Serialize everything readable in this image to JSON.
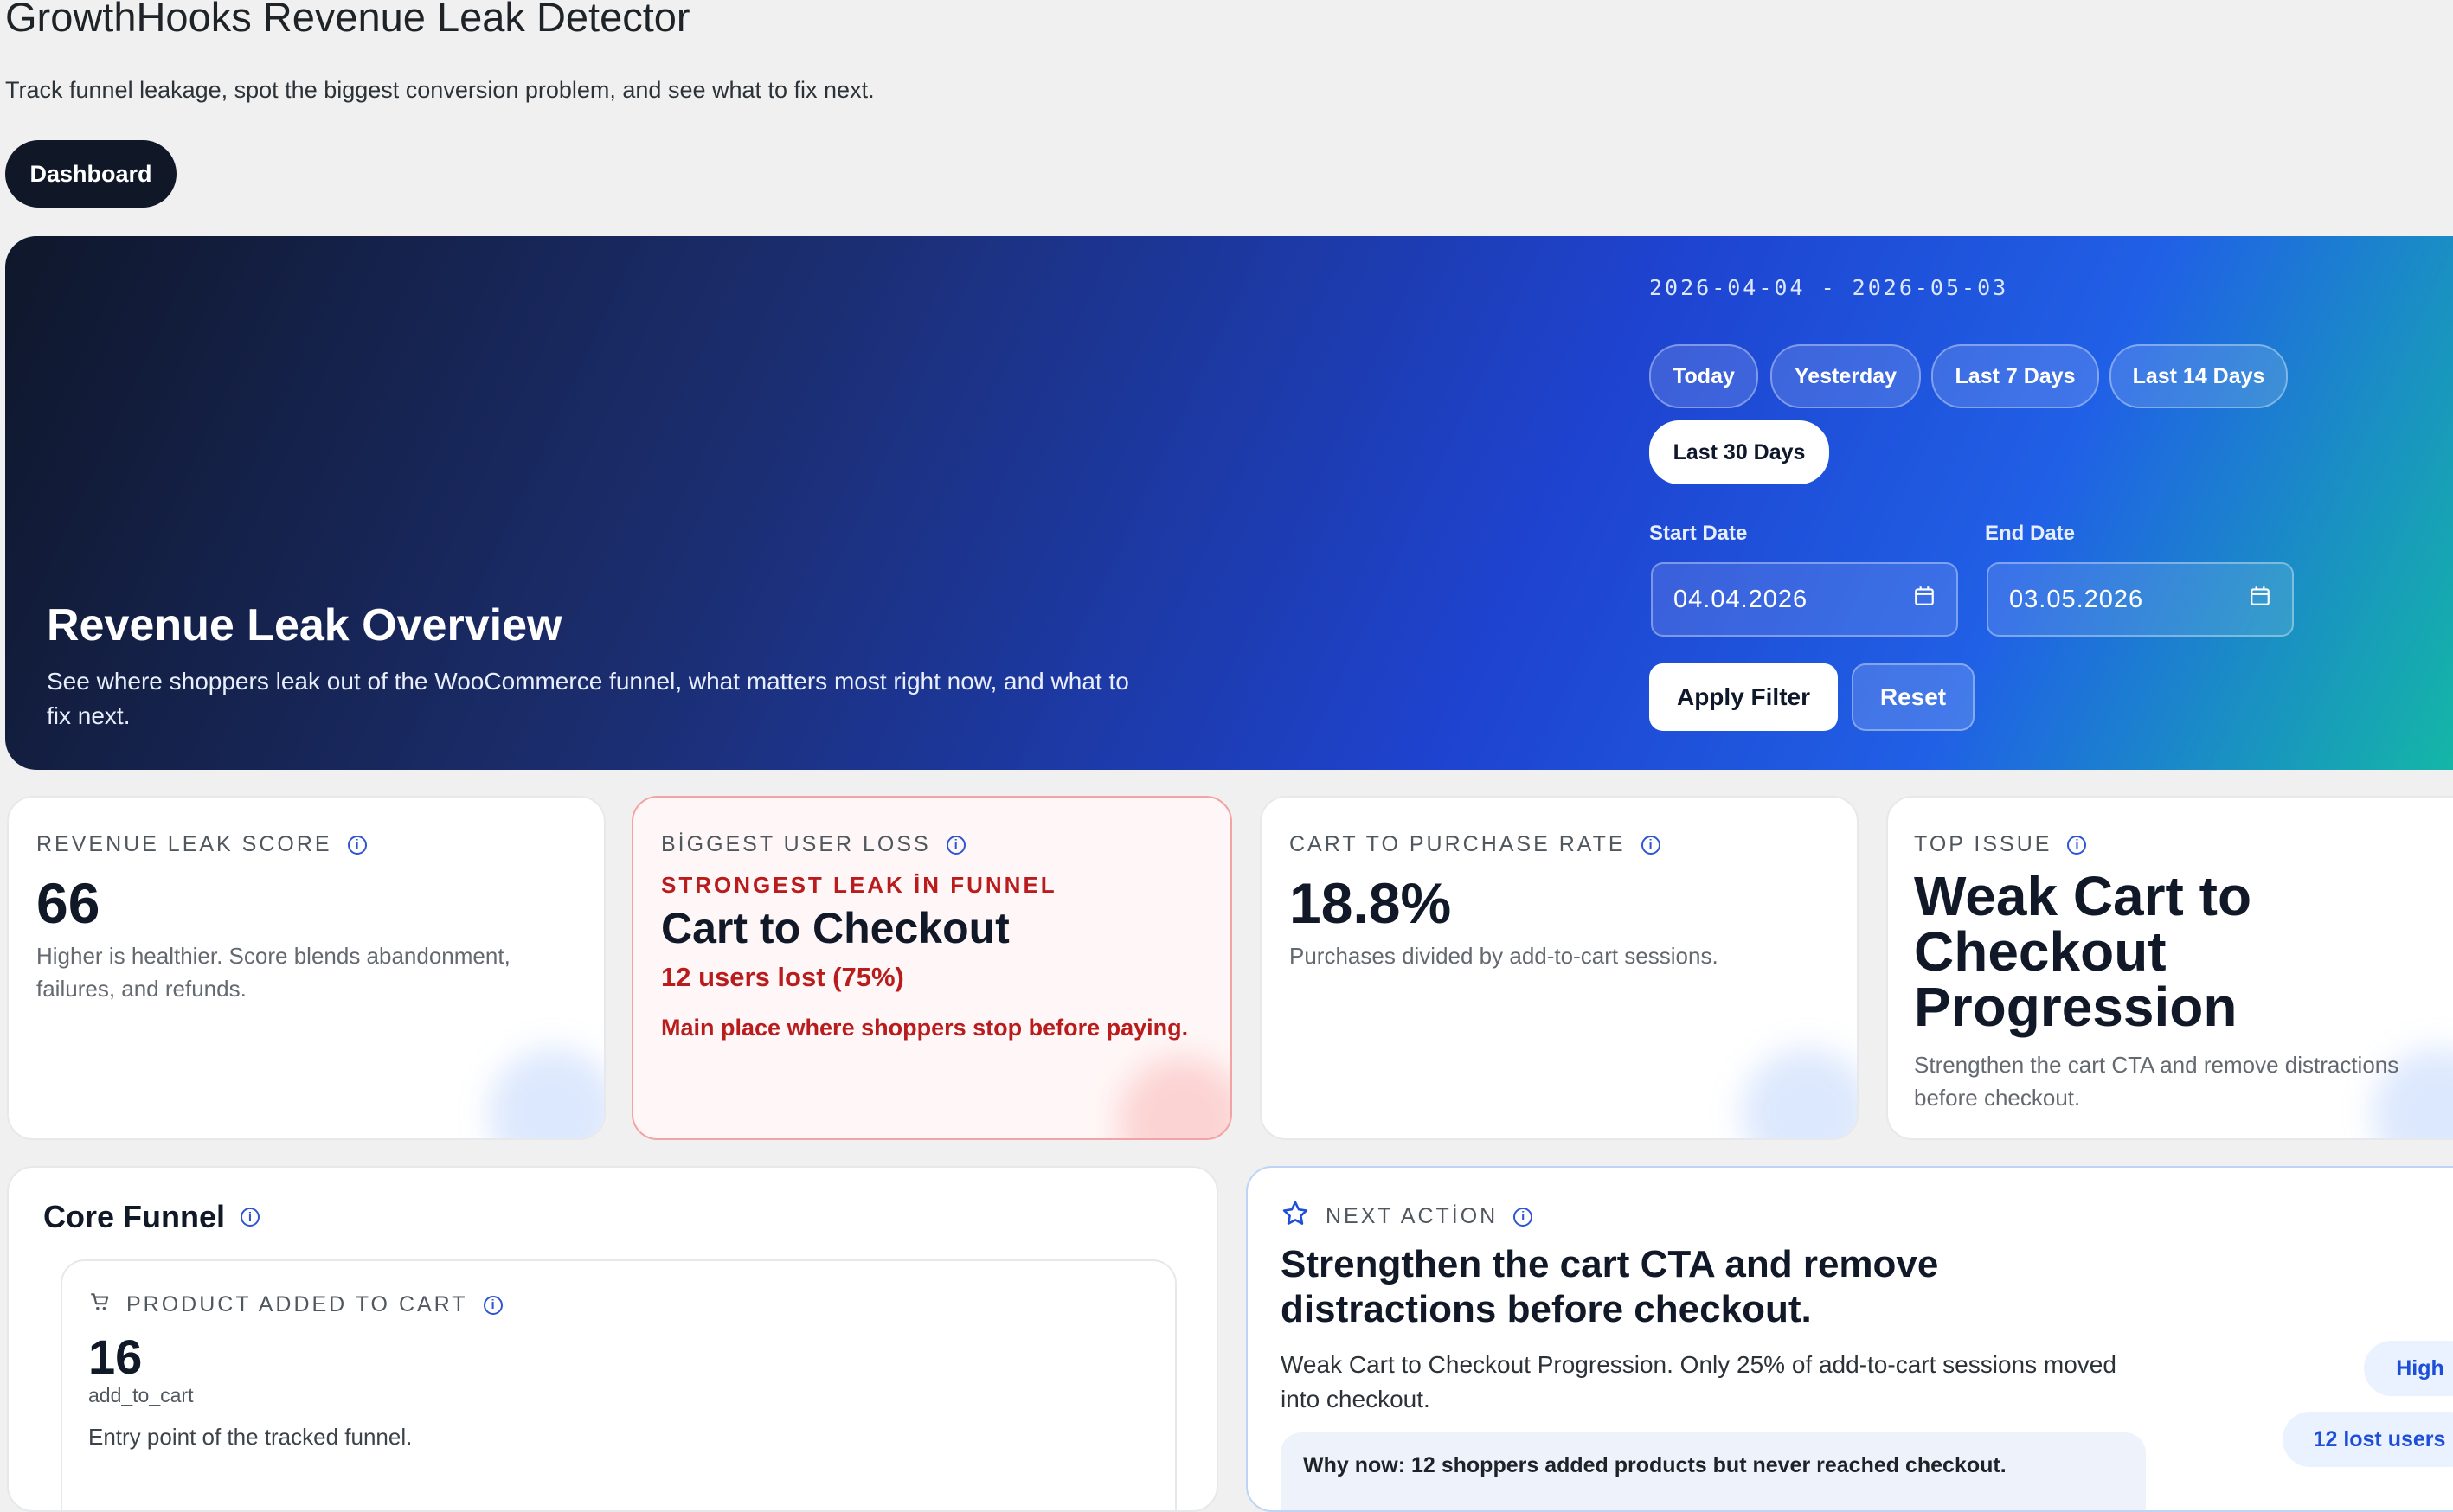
{
  "app": {
    "title": "GrowthHooks Revenue Leak Detector",
    "subtitle": "Track funnel leakage, spot the biggest conversion problem, and see what to fix next.",
    "nav_button": "Dashboard"
  },
  "hero": {
    "title": "Revenue Leak Overview",
    "description": "See where shoppers leak out of the WooCommerce funnel, what matters most right now, and what to fix next.",
    "range_text": "2026-04-04 - 2026-05-03",
    "presets": [
      "Today",
      "Yesterday",
      "Last 7 Days",
      "Last 14 Days",
      "Last 30 Days"
    ],
    "active_preset": "Last 30 Days",
    "start_label": "Start Date",
    "start_value": "04.04.2026",
    "end_label": "End Date",
    "end_value": "03.05.2026",
    "apply_label": "Apply Filter",
    "reset_label": "Reset"
  },
  "kpis": {
    "score": {
      "label": "REVENUE LEAK SCORE",
      "value": "66",
      "note": "Higher is healthier. Score blends abandonment, failures, and refunds."
    },
    "loss": {
      "label": "BİGGEST USER LOSS",
      "tag": "STRONGEST LEAK İN FUNNEL",
      "title": "Cart to Checkout",
      "lost": "12 users lost (75%)",
      "note": "Main place where shoppers stop before paying."
    },
    "rate": {
      "label": "CART TO PURCHASE RATE",
      "value": "18.8%",
      "note": "Purchases divided by add-to-cart sessions."
    },
    "issue": {
      "label": "TOP ISSUE",
      "title": "Weak Cart to Checkout Progression",
      "note": "Strengthen the cart CTA and remove distractions before checkout."
    }
  },
  "funnel": {
    "title": "Core Funnel",
    "step": {
      "label": "PRODUCT ADDED TO CART",
      "value": "16",
      "event": "add_to_cart",
      "note": "Entry point of the tracked funnel."
    }
  },
  "next_action": {
    "label": "NEXT ACTİON",
    "title": "Strengthen the cart CTA and remove distractions before checkout.",
    "description": "Weak Cart to Checkout Progression. Only 25% of add-to-cart sessions moved into checkout.",
    "why_now": "Why now: 12 shoppers added products but never reached checkout.",
    "priority": "High",
    "lost_users": "12 lost users"
  },
  "icons": [
    "info-icon",
    "calendar-icon",
    "cart-icon",
    "star-icon"
  ],
  "colors": {
    "dark": "#101828",
    "accent": "#1d4ed8",
    "danger": "#b91c1c",
    "teal": "#14b8a6"
  }
}
